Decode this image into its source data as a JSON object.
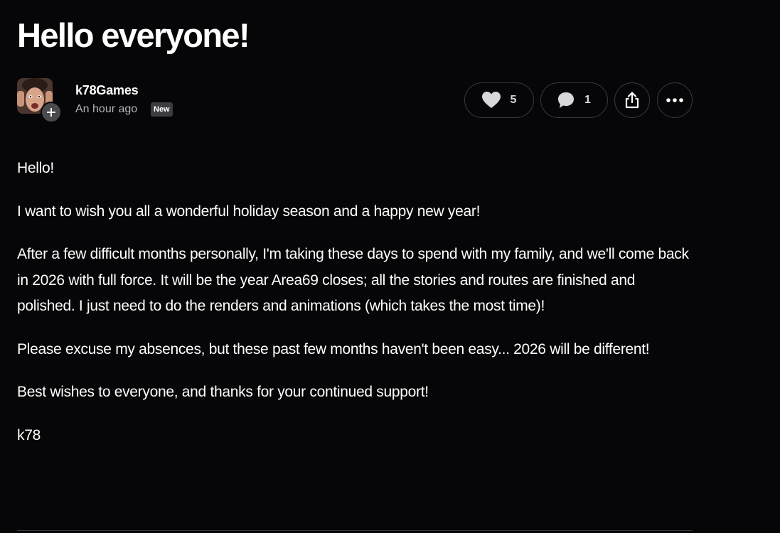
{
  "post": {
    "title": "Hello everyone!",
    "author": {
      "name": "k78Games",
      "timestamp": "An hour ago",
      "badge": "New"
    },
    "actions": {
      "likes": "5",
      "comments": "1",
      "icons": [
        "heart-icon",
        "comment-icon",
        "share-icon",
        "more-icon"
      ]
    },
    "body": {
      "p1": "Hello!",
      "p2": "I want to wish you all a wonderful holiday season and a happy new year!",
      "p3": "After a few difficult months personally, I'm taking these days to spend with my family, and we'll come back in 2026 with full force. It will be the year Area69 closes; all the stories and routes are finished and polished. I just need to do the renders and animations (which takes the most time)!",
      "p4": "Please excuse my absences, but these past few months haven't been easy... 2026 will be different!",
      "p5": "Best wishes to everyone, and thanks for your continued support!",
      "p6": "k78"
    }
  },
  "colors": {
    "background": "#060507",
    "text": "#ffffff",
    "muted": "#b4b4b8",
    "border": "#3a3a3e",
    "badge": "#3d3d40"
  }
}
